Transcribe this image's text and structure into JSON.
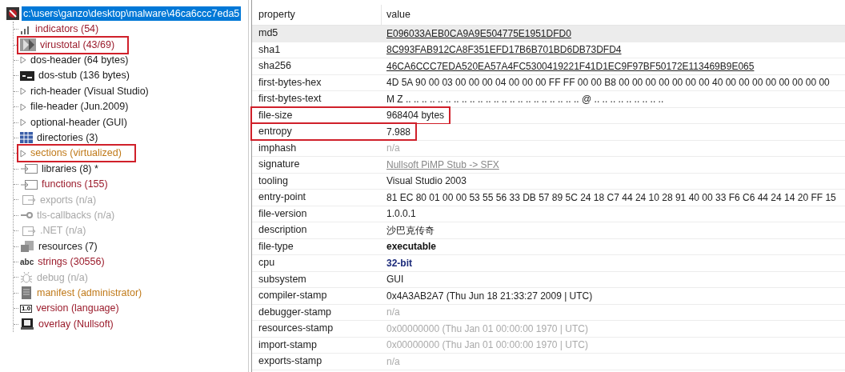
{
  "tree": {
    "root": {
      "label": "c:\\users\\ganzo\\desktop\\malware\\46ca6ccc7eda5",
      "selected": true
    },
    "items": [
      {
        "kind": "bars",
        "label": "indicators (54)",
        "color": "#9b1c2c",
        "highlighted": false
      },
      {
        "kind": "vt",
        "label": "virustotal (43/69)",
        "color": "#9b1c2c",
        "highlighted": true
      },
      {
        "kind": "arrow",
        "label": "dos-header (64 bytes)",
        "color": "#1a1a1a",
        "highlighted": false
      },
      {
        "kind": "console",
        "label": "dos-stub (136 bytes)",
        "color": "#1a1a1a",
        "highlighted": false
      },
      {
        "kind": "arrow",
        "label": "rich-header (Visual Studio)",
        "color": "#1a1a1a",
        "highlighted": false
      },
      {
        "kind": "arrow",
        "label": "file-header (Jun.2009)",
        "color": "#1a1a1a",
        "highlighted": false
      },
      {
        "kind": "arrow",
        "label": "optional-header (GUI)",
        "color": "#1a1a1a",
        "highlighted": false
      },
      {
        "kind": "grid",
        "label": "directories (3)",
        "color": "#1a1a1a",
        "highlighted": false
      },
      {
        "kind": "arrow",
        "label": "sections (virtualized)",
        "color": "#c07a1a",
        "highlighted": true
      },
      {
        "kind": "module",
        "label": "libraries (8) *",
        "color": "#1a1a1a",
        "highlighted": false
      },
      {
        "kind": "module",
        "label": "functions (155)",
        "color": "#9b1c2c",
        "highlighted": false
      },
      {
        "kind": "export",
        "label": "exports (n/a)",
        "color": "#a8a8a8",
        "highlighted": false
      },
      {
        "kind": "key",
        "label": "tls-callbacks (n/a)",
        "color": "#a8a8a8",
        "highlighted": false
      },
      {
        "kind": "export",
        "label": ".NET (n/a)",
        "color": "#a8a8a8",
        "highlighted": false
      },
      {
        "kind": "stack",
        "label": "resources (7)",
        "color": "#1a1a1a",
        "highlighted": false
      },
      {
        "kind": "abc",
        "icon_text": "abc",
        "label": "strings (30556)",
        "color": "#9b1c2c",
        "highlighted": false
      },
      {
        "kind": "bug",
        "label": "debug (n/a)",
        "color": "#a8a8a8",
        "highlighted": false
      },
      {
        "kind": "manifest",
        "label": "manifest (administrator)",
        "color": "#c07a1a",
        "highlighted": false
      },
      {
        "kind": "version",
        "icon_text": "1.0",
        "label": "version (language)",
        "color": "#9b1c2c",
        "highlighted": false
      },
      {
        "kind": "overlay",
        "label": "overlay (Nullsoft)",
        "color": "#9b1c2c",
        "highlighted": false
      }
    ]
  },
  "table": {
    "columns": [
      "property",
      "value"
    ],
    "rows": [
      {
        "property": "md5",
        "value": "E096033AEB0CA9A9E504775E1951DFD0",
        "kind": "link",
        "selected": true,
        "highlighted": false
      },
      {
        "property": "sha1",
        "value": "8C993FAB912CA8F351EFD17B6B701BD6DB73DFD4",
        "kind": "link",
        "selected": false,
        "highlighted": false
      },
      {
        "property": "sha256",
        "value": "46CA6CCC7EDA520EA57A4FC5300419221F41D1EC9F97BF50172E113469B9E065",
        "kind": "link",
        "selected": false,
        "highlighted": false
      },
      {
        "property": "first-bytes-hex",
        "value": "4D 5A 90 00 03 00 00 00 04 00 00 00 FF FF 00 00 B8 00 00 00 00 00 00 00 40 00 00 00 00 00 00 00 00",
        "kind": "plain",
        "selected": false,
        "highlighted": false
      },
      {
        "property": "first-bytes-text",
        "value": "M Z .. .. .. .. .. .. .. .. .. .. .. .. .. .. .. .. .. .. .. .. .. .. @ .. .. .. .. .. .. .. .. ..",
        "kind": "plain",
        "selected": false,
        "highlighted": false
      },
      {
        "property": "file-size",
        "value": "968404 bytes",
        "kind": "plain",
        "selected": false,
        "highlighted": true
      },
      {
        "property": "entropy",
        "value": "7.988",
        "kind": "plain",
        "selected": false,
        "highlighted": true
      },
      {
        "property": "imphash",
        "value": "n/a",
        "kind": "muted",
        "selected": false,
        "highlighted": false
      },
      {
        "property": "signature",
        "value": "Nullsoft PiMP Stub -> SFX",
        "kind": "mutedlink",
        "selected": false,
        "highlighted": false
      },
      {
        "property": "tooling",
        "value": "Visual Studio 2003",
        "kind": "plain",
        "selected": false,
        "highlighted": false
      },
      {
        "property": "entry-point",
        "value": "81 EC 80 01 00 00 53 55 56 33 DB 57 89 5C 24 18 C7 44 24 10 28 91 40 00 33 F6 C6 44 24 14 20 FF 15",
        "kind": "plain",
        "selected": false,
        "highlighted": false
      },
      {
        "property": "file-version",
        "value": "1.0.0.1",
        "kind": "plain",
        "selected": false,
        "highlighted": false
      },
      {
        "property": "description",
        "value": "沙巴克传奇",
        "kind": "plain",
        "selected": false,
        "highlighted": false
      },
      {
        "property": "file-type",
        "value": "executable",
        "kind": "bold",
        "selected": false,
        "highlighted": false
      },
      {
        "property": "cpu",
        "value": "32-bit",
        "kind": "accent",
        "selected": false,
        "highlighted": false
      },
      {
        "property": "subsystem",
        "value": "GUI",
        "kind": "plain",
        "selected": false,
        "highlighted": false
      },
      {
        "property": "compiler-stamp",
        "value": "0x4A3AB2A7 (Thu Jun 18 21:33:27 2009 | UTC)",
        "kind": "plain",
        "selected": false,
        "highlighted": false
      },
      {
        "property": "debugger-stamp",
        "value": "n/a",
        "kind": "muted",
        "selected": false,
        "highlighted": false
      },
      {
        "property": "resources-stamp",
        "value": "0x00000000 (Thu Jan 01 00:00:00 1970 | UTC)",
        "kind": "muted",
        "selected": false,
        "highlighted": false
      },
      {
        "property": "import-stamp",
        "value": "0x00000000 (Thu Jan 01 00:00:00 1970 | UTC)",
        "kind": "muted",
        "selected": false,
        "highlighted": false
      },
      {
        "property": "exports-stamp",
        "value": "n/a",
        "kind": "muted",
        "selected": false,
        "highlighted": false
      }
    ]
  }
}
